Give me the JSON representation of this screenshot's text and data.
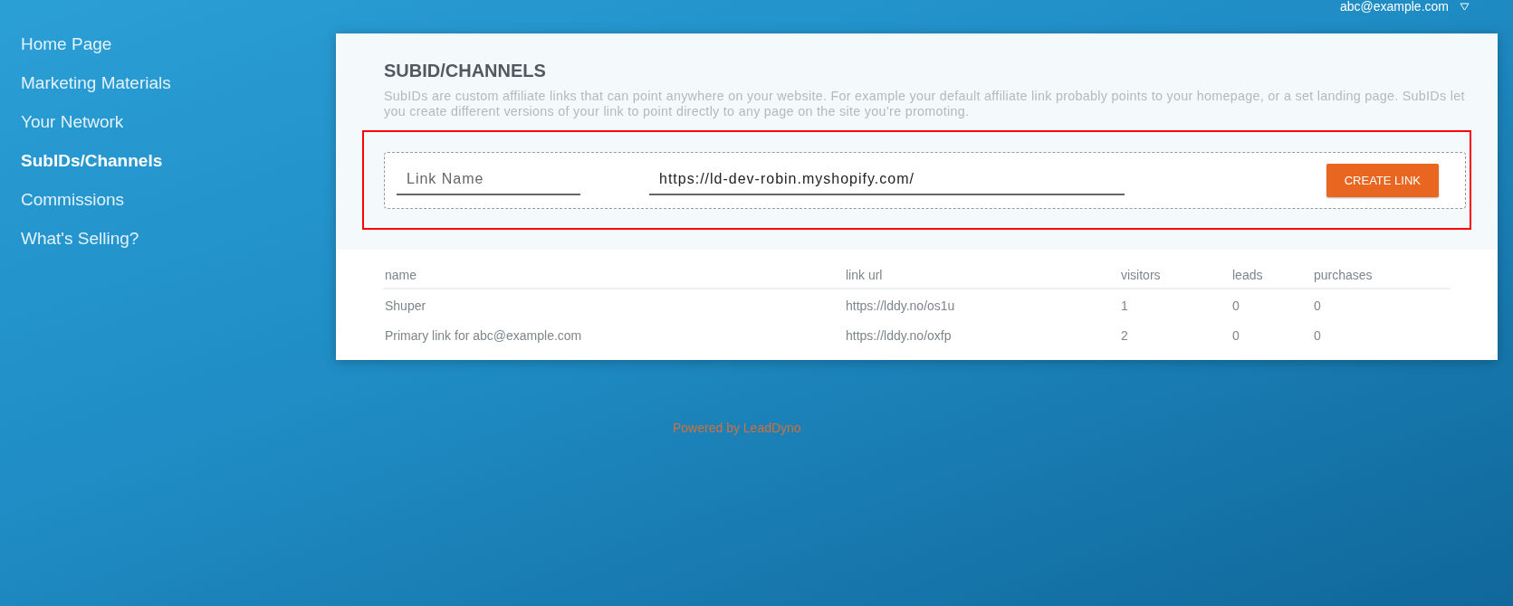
{
  "user_menu": {
    "email": "abc@example.com"
  },
  "sidebar": {
    "items": [
      {
        "label": "Home Page",
        "selected": false
      },
      {
        "label": "Marketing Materials",
        "selected": false
      },
      {
        "label": "Your Network",
        "selected": false
      },
      {
        "label": "SubIDs/Channels",
        "selected": true
      },
      {
        "label": "Commissions",
        "selected": false
      },
      {
        "label": "What's Selling?",
        "selected": false
      }
    ]
  },
  "panel": {
    "title": "SUBID/CHANNELS",
    "description": "SubIDs are custom affiliate links that can point anywhere on your website. For example your default affiliate link probably points to your homepage, or a set landing page. SubIDs let you create different versions of your link to point directly to any page on the site you’re promoting.",
    "form": {
      "link_name": {
        "placeholder": "Link Name"
      },
      "link_url": {
        "value": "https://ld-dev-robin.myshopify.com/"
      },
      "button": "CREATE LINK"
    }
  },
  "table": {
    "columns": [
      "name",
      "link url",
      "visitors",
      "leads",
      "purchases"
    ],
    "rows": [
      [
        "Shuper",
        "https://lddy.no/os1u",
        "1",
        "0",
        "0"
      ],
      [
        "Primary link for abc@example.com",
        "https://lddy.no/oxfp",
        "2",
        "0",
        "0"
      ]
    ]
  },
  "footer": {
    "text": "Powered by LeadDyno"
  }
}
